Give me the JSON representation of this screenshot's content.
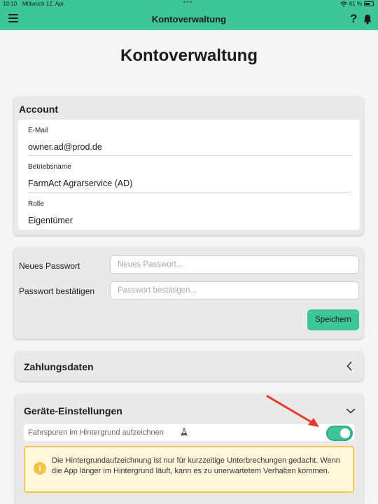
{
  "status_bar": {
    "time": "10:10",
    "date": "Mittwoch 12. Apr.",
    "battery": "61 %",
    "battery_level": 0.61
  },
  "navbar": {
    "title": "Kontoverwaltung",
    "help_label": "?"
  },
  "page": {
    "title": "Kontoverwaltung"
  },
  "account": {
    "title": "Account",
    "fields": [
      {
        "label": "E-Mail",
        "value": "owner.ad@prod.de"
      },
      {
        "label": "Betriebsname",
        "value": "FarmAct Agrarservice (AD)"
      },
      {
        "label": "Rolle",
        "value": "Eigentümer"
      }
    ]
  },
  "password": {
    "new_label": "Neues Passwort",
    "new_placeholder": "Neues Passwort...",
    "confirm_label": "Passwort bestätigen",
    "confirm_placeholder": "Passwort bestätigen...",
    "save_label": "Speichern"
  },
  "payment": {
    "title": "Zahlungsdaten"
  },
  "device": {
    "title": "Geräte-Einstellungen",
    "toggle_label": "Fahrspuren im Hintergrund aufzeichnen",
    "toggle_on": true,
    "notice": "Die Hintergrundaufzeichnung ist nur für kurzzeitige Unterbrechungen gedacht. Wenn die App länger im Hintergrund läuft, kann es zu unerwartetem Verhalten kommen."
  },
  "colors": {
    "accent": "#3ec59a",
    "warning_border": "#f2c94c",
    "warning_bg": "#fff8dd",
    "annotation_arrow": "#e8382a"
  },
  "icons": [
    "menu-icon",
    "help-icon",
    "bell-icon",
    "wifi-icon",
    "battery-icon",
    "chevron-left-icon",
    "chevron-down-icon",
    "flask-icon",
    "info-icon",
    "red-arrow-annotation"
  ]
}
